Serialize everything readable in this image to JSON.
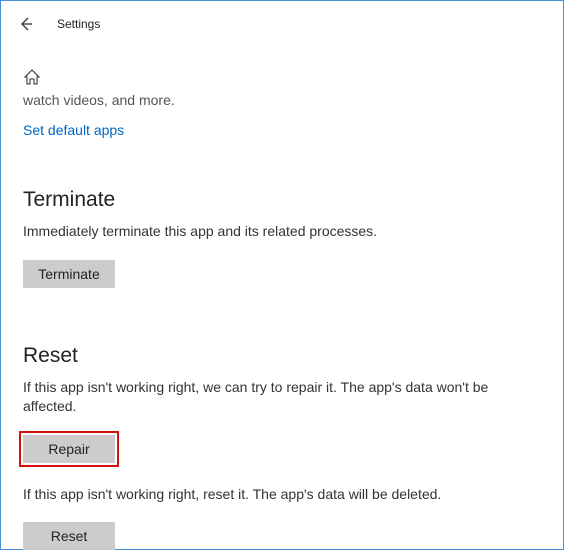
{
  "header": {
    "title": "Settings"
  },
  "content": {
    "cutoff_text": "watch videos, and more.",
    "default_apps_link": "Set default apps"
  },
  "terminate": {
    "title": "Terminate",
    "desc": "Immediately terminate this app and its related processes.",
    "button": "Terminate"
  },
  "reset": {
    "title": "Reset",
    "desc1": "If this app isn't working right, we can try to repair it. The app's data won't be affected.",
    "repair_button": "Repair",
    "desc2": "If this app isn't working right, reset it. The app's data will be deleted.",
    "reset_button": "Reset"
  }
}
